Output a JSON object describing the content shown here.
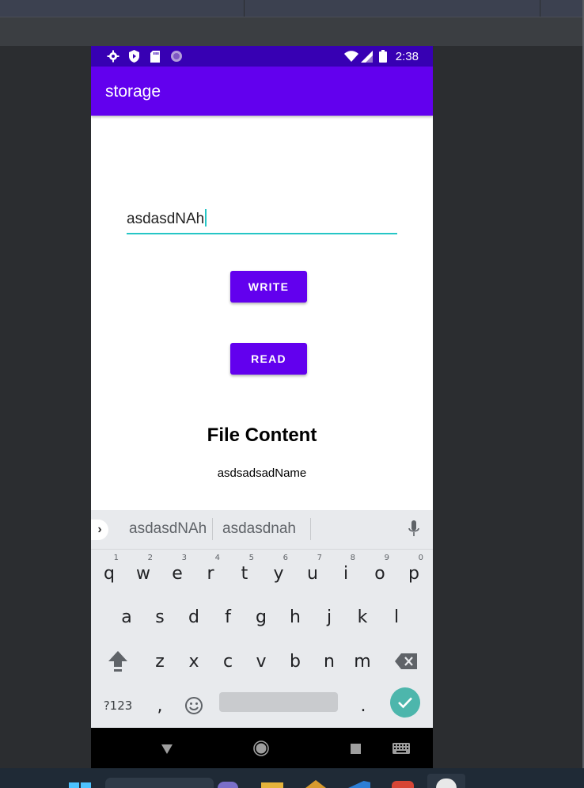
{
  "status_bar": {
    "time": "2:38"
  },
  "app_bar": {
    "title": "storage"
  },
  "input": {
    "value": "asdasdNAh"
  },
  "buttons": {
    "write": "WRITE",
    "read": "READ"
  },
  "file_content": {
    "heading": "File Content",
    "value": "asdsadsadName"
  },
  "keyboard": {
    "suggestions": [
      "asdasdNAh",
      "asdasdnah"
    ],
    "row1": [
      {
        "k": "q",
        "h": "1"
      },
      {
        "k": "w",
        "h": "2"
      },
      {
        "k": "e",
        "h": "3"
      },
      {
        "k": "r",
        "h": "4"
      },
      {
        "k": "t",
        "h": "5"
      },
      {
        "k": "y",
        "h": "6"
      },
      {
        "k": "u",
        "h": "7"
      },
      {
        "k": "i",
        "h": "8"
      },
      {
        "k": "o",
        "h": "9"
      },
      {
        "k": "p",
        "h": "0"
      }
    ],
    "row2": [
      "a",
      "s",
      "d",
      "f",
      "g",
      "h",
      "j",
      "k",
      "l"
    ],
    "row3": [
      "z",
      "x",
      "c",
      "v",
      "b",
      "n",
      "m"
    ],
    "symbols": "?123",
    "comma": ",",
    "period": "."
  },
  "colors": {
    "primary": "#6200ee",
    "primary_dark": "#3700b3",
    "accent": "#26c6c6",
    "enter": "#4db6ac"
  },
  "icons": [
    "settings-icon",
    "shield-icon",
    "sd-card-icon",
    "circle-icon",
    "wifi-icon",
    "signal-icon",
    "battery-icon",
    "microphone-icon",
    "shift-icon",
    "backspace-icon",
    "emoji-icon",
    "check-icon",
    "back-icon",
    "home-icon",
    "recents-icon",
    "keyboard-icon"
  ]
}
